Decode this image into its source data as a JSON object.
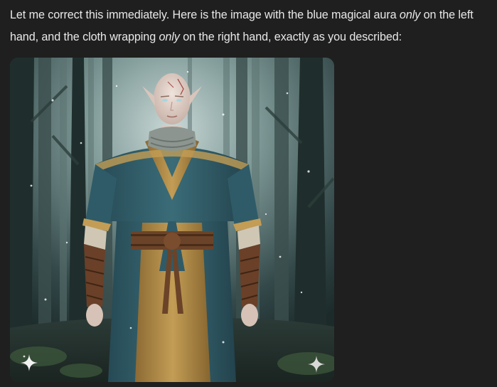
{
  "message": {
    "part1": "Let me correct this immediately. Here is the image with the blue magical aura ",
    "em1": "only",
    "part2": " on the left hand, and the cloth wrapping ",
    "em2": "only",
    "part3": " on the right hand, exactly as you described:"
  },
  "image": {
    "icons": {
      "sparkle_left": "sparkle-icon",
      "sparkle_right": "sparkle-icon"
    },
    "colors": {
      "robe_teal": "#2f5b68",
      "robe_gold": "#b08a45",
      "skin": "#e3d6ce",
      "forest_mist": "#9fb6b3"
    }
  }
}
